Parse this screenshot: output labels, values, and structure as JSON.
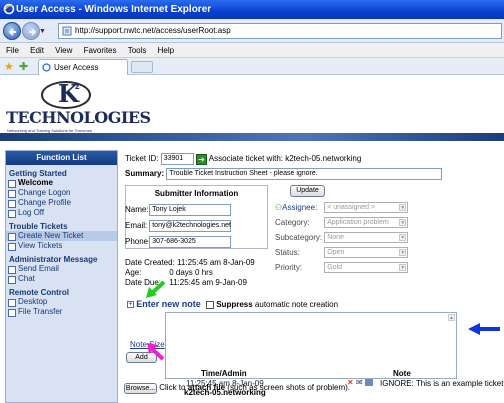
{
  "window": {
    "title": "User Access - Windows Internet Explorer"
  },
  "address": {
    "url": "http://support.nwtc.net/access/userRoot.asp"
  },
  "menu": [
    "File",
    "Edit",
    "View",
    "Favorites",
    "Tools",
    "Help"
  ],
  "tab": {
    "label": "User Access"
  },
  "logo": {
    "brand": "K",
    "sup": "2",
    "name": "TECHNOLOGIES",
    "tagline": "Networking and Training Solutions for Tomorrow"
  },
  "sidebar": {
    "title": "Function List",
    "groups": [
      {
        "label": "Getting Started",
        "items": [
          "Welcome",
          "Change Logon",
          "Change Profile",
          "Log Off"
        ]
      },
      {
        "label": "Trouble Tickets",
        "items": [
          "Create New Ticket",
          "View Tickets"
        ]
      },
      {
        "label": "Administrator Message",
        "items": [
          "Send Email",
          "Chat"
        ]
      },
      {
        "label": "Remote Control",
        "items": [
          "Desktop",
          "File Transfer"
        ]
      }
    ]
  },
  "ticket": {
    "id_label": "Ticket ID:",
    "id_value": "33901",
    "associate_label": "Associate ticket with:",
    "associate_value": "k2tech-05.networking",
    "summary_label": "Summary:",
    "summary_value": "Trouble Ticket Instruction Sheet - please ignore."
  },
  "submitter": {
    "title": "Submitter Information",
    "name_label": "Name:",
    "name_value": "Tony Lojek",
    "email_label": "Email:",
    "email_value": "tony@k2technologies.net",
    "phone_label": "Phone:",
    "phone_value": "307-686-3025"
  },
  "dates": {
    "created_label": "Date Created:",
    "created_value": "11:25:45 am 8-Jan-09",
    "age_label": "Age:",
    "age_value": "0 days 0 hrs",
    "due_label": "Date Due:",
    "due_value": "11:25:45 am 9-Jan-09"
  },
  "fields": {
    "update": "Update",
    "assignee_label": "Assignee:",
    "assignee_value": "< unassigned >",
    "category_label": "Category:",
    "category_value": "Application problem",
    "subcategory_label": "Subcategory:",
    "subcategory_value": "None",
    "status_label": "Status:",
    "status_value": "Open",
    "priority_label": "Priority:",
    "priority_value": "Gold"
  },
  "note": {
    "enter_new_note": "Enter new note",
    "suppress_label_bold": "Suppress",
    "suppress_label_rest": "automatic note creation",
    "note_size": "Note Size",
    "add": "Add",
    "browse": "Browse...",
    "attach_pre": "Click to",
    "attach_bold": "attach file",
    "attach_post": "(such as screen shots of problem)."
  },
  "notes_table": {
    "col_time": "Time/Admin",
    "col_note": "Note",
    "rows": [
      {
        "time": "11:25:45 am 8-Jan-09",
        "admin": "k2tech-05.networking",
        "note": "IGNORE: This is an example ticket for T"
      }
    ]
  },
  "colors": {
    "arrow_green": "#22cc22",
    "arrow_pink": "#ee22cc",
    "arrow_blue": "#1133dd",
    "brand_navy": "#1d2a5a"
  }
}
